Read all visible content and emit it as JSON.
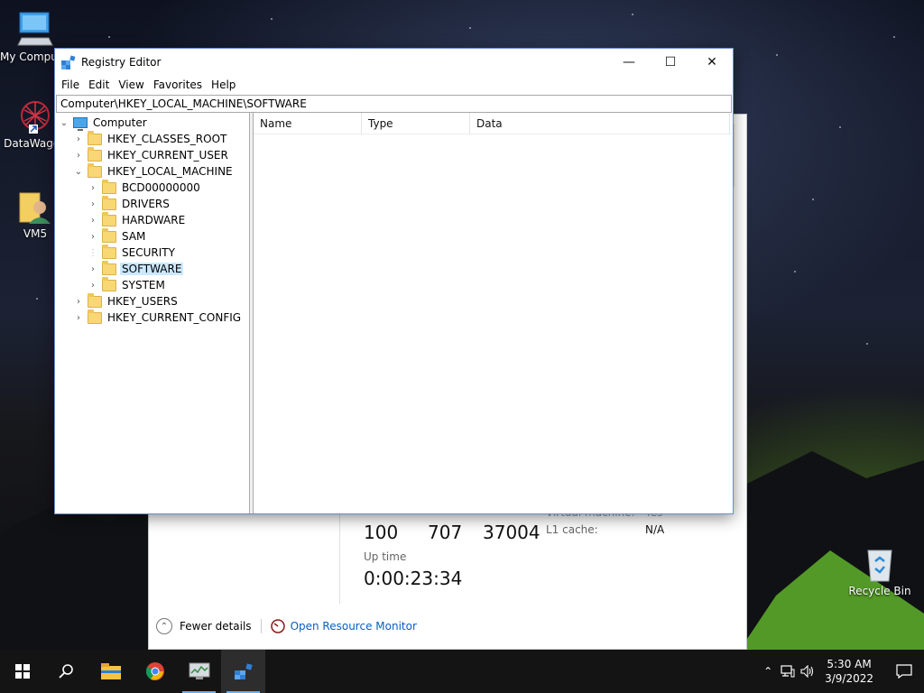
{
  "desktop": {
    "icons": [
      {
        "label": "My Computer",
        "icon": "computer-icon"
      },
      {
        "label": "DataWagon",
        "icon": "datawagon-shortcut-icon"
      },
      {
        "label": "VM5",
        "icon": "user-folder-icon"
      },
      {
        "label": "Recycle Bin",
        "icon": "recycle-bin-icon"
      }
    ]
  },
  "taskmgr": {
    "numbers": [
      "100",
      "707",
      "37004"
    ],
    "virtual_machine_label": "Virtual machine:",
    "virtual_machine_value": "Yes",
    "l1_cache_label": "L1 cache:",
    "l1_cache_value": "N/A",
    "uptime_label": "Up time",
    "uptime_value": "0:00:23:34",
    "fewer_details": "Fewer details",
    "open_resource_monitor": "Open Resource Monitor"
  },
  "regedit": {
    "title": "Registry Editor",
    "menu": [
      "File",
      "Edit",
      "View",
      "Favorites",
      "Help"
    ],
    "address": "Computer\\HKEY_LOCAL_MACHINE\\SOFTWARE",
    "tree": [
      {
        "label": "Computer",
        "level": 0,
        "expanded": true,
        "type": "computer"
      },
      {
        "label": "HKEY_CLASSES_ROOT",
        "level": 1,
        "expanded": false,
        "type": "folder"
      },
      {
        "label": "HKEY_CURRENT_USER",
        "level": 1,
        "expanded": false,
        "type": "folder"
      },
      {
        "label": "HKEY_LOCAL_MACHINE",
        "level": 1,
        "expanded": true,
        "type": "folder"
      },
      {
        "label": "BCD00000000",
        "level": 2,
        "expanded": false,
        "type": "folder"
      },
      {
        "label": "DRIVERS",
        "level": 2,
        "expanded": false,
        "type": "folder"
      },
      {
        "label": "HARDWARE",
        "level": 2,
        "expanded": false,
        "type": "folder"
      },
      {
        "label": "SAM",
        "level": 2,
        "expanded": false,
        "type": "folder"
      },
      {
        "label": "SECURITY",
        "level": 2,
        "expanded": null,
        "type": "folder"
      },
      {
        "label": "SOFTWARE",
        "level": 2,
        "expanded": false,
        "type": "folder",
        "selected": true
      },
      {
        "label": "SYSTEM",
        "level": 2,
        "expanded": false,
        "type": "folder"
      },
      {
        "label": "HKEY_USERS",
        "level": 1,
        "expanded": false,
        "type": "folder"
      },
      {
        "label": "HKEY_CURRENT_CONFIG",
        "level": 1,
        "expanded": false,
        "type": "folder"
      }
    ],
    "columns": [
      "Name",
      "Type",
      "Data"
    ]
  },
  "taskbar": {
    "apps": [
      "start-icon",
      "search-icon",
      "file-explorer-icon",
      "chrome-icon",
      "task-manager-icon",
      "registry-editor-icon"
    ],
    "time": "5:30 AM",
    "date": "3/9/2022"
  }
}
